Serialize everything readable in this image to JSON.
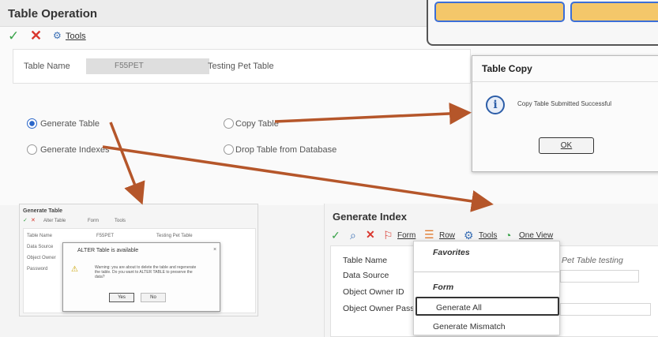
{
  "main": {
    "title": "Table Operation",
    "toolbar": {
      "tools_label": "Tools"
    },
    "table_name_label": "Table Name",
    "table_name_value": "F55PET",
    "table_description": "Testing Pet Table",
    "options": [
      {
        "label": "Generate Table",
        "selected": true
      },
      {
        "label": "Copy Table",
        "selected": false
      },
      {
        "label": "Generate Indexes",
        "selected": false
      },
      {
        "label": "Drop Table from Database",
        "selected": false
      }
    ]
  },
  "table_copy_dialog": {
    "title": "Table Copy",
    "message": "Copy Table Submitted Successful",
    "ok_label": "OK"
  },
  "generate_table": {
    "title": "Generate Table",
    "toolbar": [
      "Alter Table",
      "Form",
      "Tools"
    ],
    "fields": [
      "Table Name",
      "Data Source",
      "Object Owner",
      "Password"
    ],
    "table_name_value": "F55PET",
    "table_description": "Testing Pet Table",
    "dialog": {
      "title": "ALTER Table is available",
      "message": "Warning: you are about to delete the table and regenerate the table. Do you want to ALTER TABLE to preserve the data?",
      "yes_label": "Yes",
      "no_label": "No"
    }
  },
  "generate_index": {
    "title": "Generate Index",
    "toolbar": {
      "form": "Form",
      "row": "Row",
      "tools": "Tools",
      "one_view": "One View"
    },
    "fields": [
      "Table Name",
      "Data Source",
      "Object Owner ID",
      "Object Owner Password"
    ],
    "table_description": "Pet Table testing",
    "dropdown": {
      "favorites": "Favorites",
      "form": "Form",
      "generate_all": "Generate All",
      "generate_mismatch": "Generate Mismatch"
    }
  },
  "colors": {
    "arrow": "#b5562a",
    "accent_blue": "#2a66c9",
    "check_green": "#3aa34a",
    "x_red": "#d9372e"
  }
}
